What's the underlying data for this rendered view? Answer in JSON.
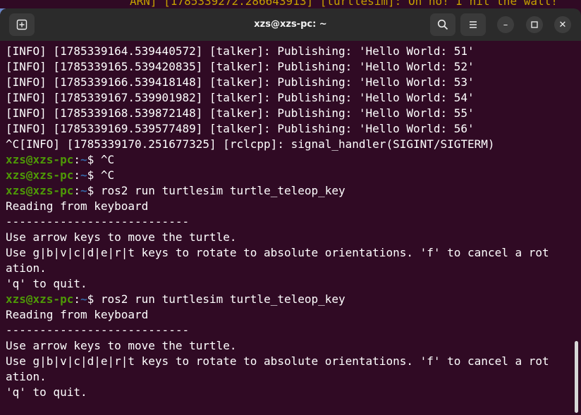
{
  "background_window": {
    "text": "ARN] [1785339272.286643913] [turtlesim]: Oh no! I hit the wall!"
  },
  "window": {
    "title": "xzs@xzs-pc: ~"
  },
  "titlebar": {
    "newtab_icon": "new-tab-icon",
    "search_icon": "search-icon",
    "menu_icon": "hamburger-menu-icon",
    "minimize_glyph": "–",
    "maximize_glyph": "☐",
    "close_glyph": "✕"
  },
  "colors": {
    "terminal_bg": "#300a24",
    "titlebar_bg": "#2b2b2b",
    "prompt_user": "#4e9a06",
    "prompt_path": "#3465a4",
    "text": "#ffffff"
  },
  "terminal": {
    "lines": [
      {
        "text": "[INFO] [1785339164.539440572] [talker]: Publishing: 'Hello World: 51'"
      },
      {
        "text": "[INFO] [1785339165.539420835] [talker]: Publishing: 'Hello World: 52'"
      },
      {
        "text": "[INFO] [1785339166.539418148] [talker]: Publishing: 'Hello World: 53'"
      },
      {
        "text": "[INFO] [1785339167.539901982] [talker]: Publishing: 'Hello World: 54'"
      },
      {
        "text": "[INFO] [1785339168.539872148] [talker]: Publishing: 'Hello World: 55'"
      },
      {
        "text": "[INFO] [1785339169.539577489] [talker]: Publishing: 'Hello World: 56'"
      },
      {
        "text": "^C[INFO] [1785339170.251677325] [rclcpp]: signal_handler(SIGINT/SIGTERM)"
      },
      {
        "user": "xzs@xzs-pc",
        "sep": ":",
        "path": "~",
        "cmd": "$ ^C"
      },
      {
        "user": "xzs@xzs-pc",
        "sep": ":",
        "path": "~",
        "cmd": "$ ^C"
      },
      {
        "user": "xzs@xzs-pc",
        "sep": ":",
        "path": "~",
        "cmd": "$ ros2 run turtlesim turtle_teleop_key"
      },
      {
        "text": "Reading from keyboard"
      },
      {
        "text": "---------------------------"
      },
      {
        "text": "Use arrow keys to move the turtle."
      },
      {
        "text": "Use g|b|v|c|d|e|r|t keys to rotate to absolute orientations. 'f' to cancel a rot"
      },
      {
        "text": "ation."
      },
      {
        "text": "'q' to quit."
      },
      {
        "user": "xzs@xzs-pc",
        "sep": ":",
        "path": "~",
        "cmd": "$ ros2 run turtlesim turtle_teleop_key"
      },
      {
        "text": "Reading from keyboard"
      },
      {
        "text": "---------------------------"
      },
      {
        "text": "Use arrow keys to move the turtle."
      },
      {
        "text": "Use g|b|v|c|d|e|r|t keys to rotate to absolute orientations. 'f' to cancel a rot"
      },
      {
        "text": "ation."
      },
      {
        "text": "'q' to quit."
      }
    ]
  }
}
